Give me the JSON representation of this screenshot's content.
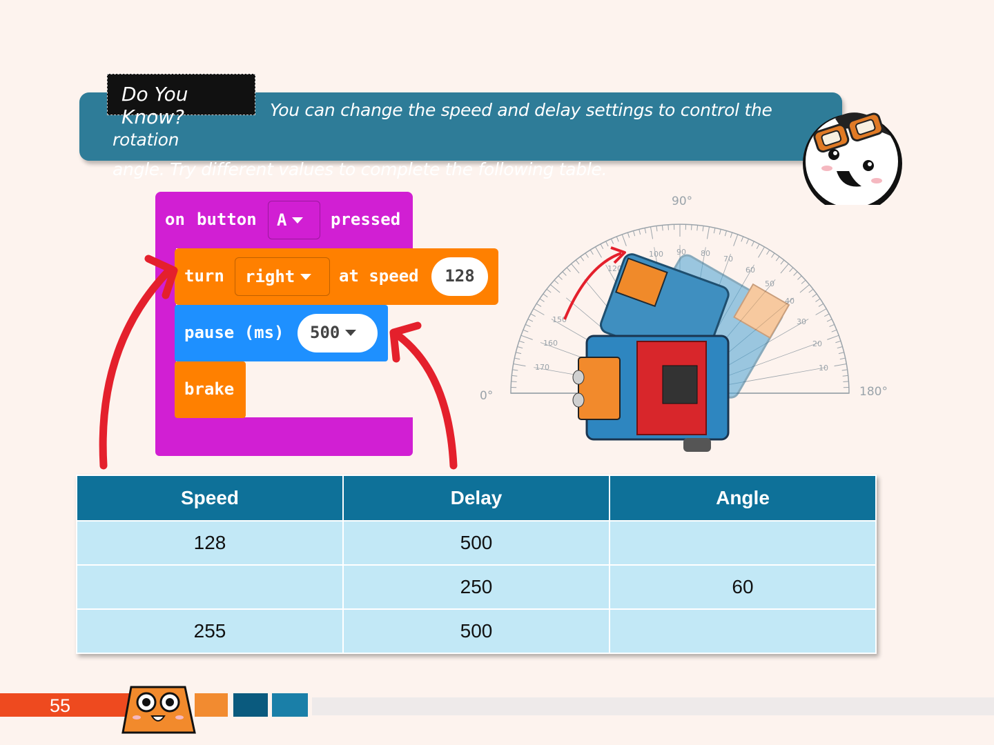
{
  "banner": {
    "label": "Do You Know?",
    "text_line1": "You can change the speed and delay settings to control the rotation",
    "text_line2": "angle. Try different values to complete the following table."
  },
  "code": {
    "hat": {
      "on": "on",
      "button": "button",
      "button_value": "A",
      "pressed": "pressed"
    },
    "turn": {
      "turn": "turn",
      "direction": "right",
      "at_speed": "at speed",
      "speed": "128"
    },
    "pause": {
      "label": "pause (ms)",
      "value": "500"
    },
    "brake": "brake"
  },
  "protractor": {
    "top_label": "90°",
    "left_label": "0°",
    "right_label": "180°",
    "ticks": [
      "10",
      "20",
      "30",
      "40",
      "50",
      "60",
      "70",
      "80",
      "90",
      "100",
      "110",
      "120",
      "150",
      "160",
      "170"
    ]
  },
  "table": {
    "headers": [
      "Speed",
      "Delay",
      "Angle"
    ],
    "rows": [
      [
        "128",
        "500",
        ""
      ],
      [
        "",
        "250",
        "60"
      ],
      [
        "255",
        "500",
        ""
      ]
    ]
  },
  "footer": {
    "page_number": "55"
  },
  "colors": {
    "banner": "#2e7c98",
    "hat_block": "#d11fd3",
    "motor_block": "#ff8000",
    "pause_block": "#1e90ff",
    "table_header": "#0e7199",
    "table_cell": "#c2e8f6",
    "arrow": "#e4202c"
  }
}
